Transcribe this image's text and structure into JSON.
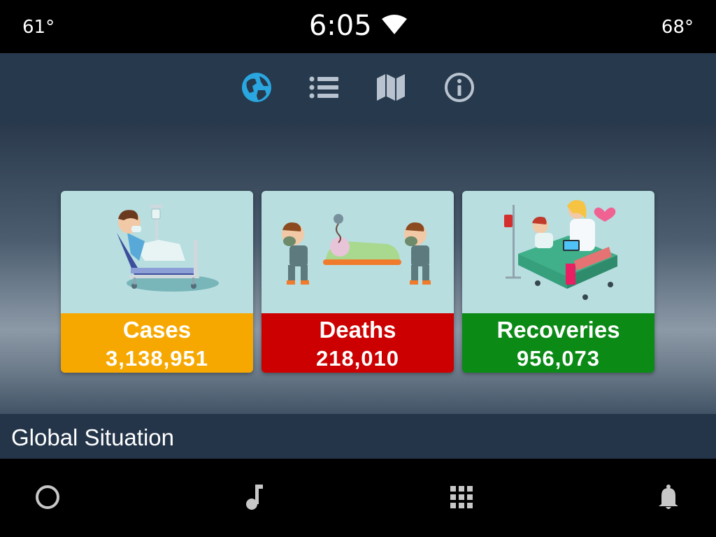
{
  "status": {
    "temp_left": "61°",
    "time": "6:05",
    "temp_right": "68°"
  },
  "nav": {
    "items": [
      {
        "icon": "globe-icon",
        "active": true
      },
      {
        "icon": "list-icon",
        "active": false
      },
      {
        "icon": "map-icon",
        "active": false
      },
      {
        "icon": "info-icon",
        "active": false
      }
    ],
    "accent": "#2aa6e0"
  },
  "cards": [
    {
      "label": "Cases",
      "count": "3,138,951",
      "color": "#f7a800"
    },
    {
      "label": "Deaths",
      "count": "218,010",
      "color": "#cc0000"
    },
    {
      "label": "Recoveries",
      "count": "956,073",
      "color": "#0b8a16"
    }
  ],
  "section": {
    "title": "Global Situation"
  },
  "dock": {
    "items": [
      "home-circle-icon",
      "music-note-icon",
      "apps-grid-icon",
      "bell-icon"
    ]
  }
}
